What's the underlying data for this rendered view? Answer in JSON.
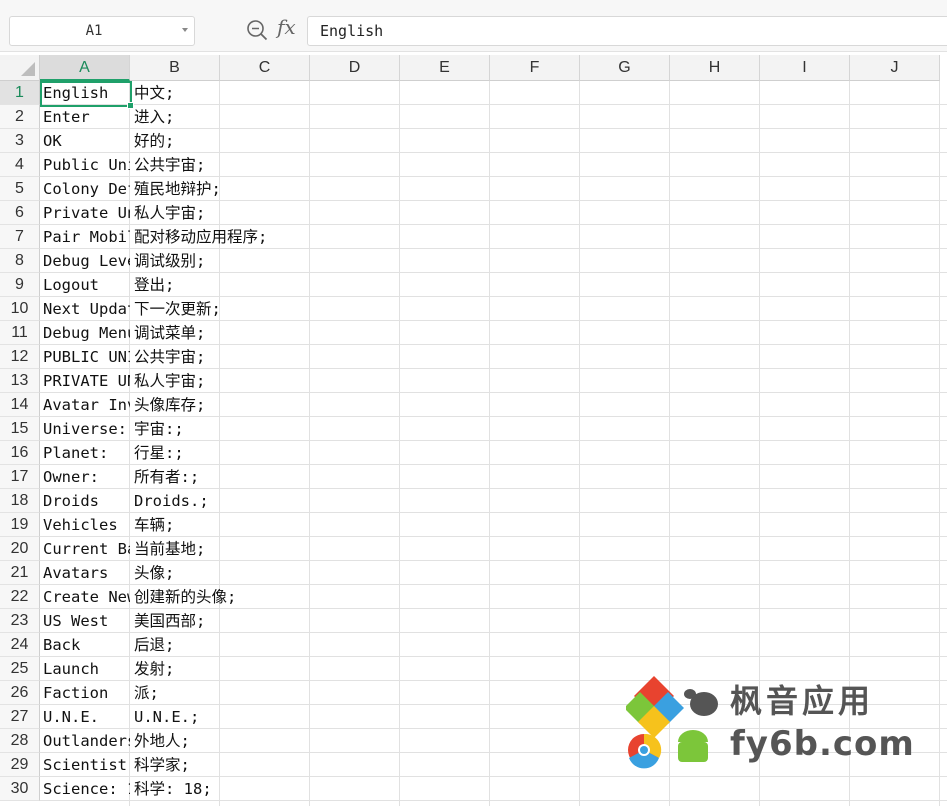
{
  "formula_bar": {
    "cell_ref": "A1",
    "fx_label": "fx",
    "content": "English"
  },
  "columns": [
    "A",
    "B",
    "C",
    "D",
    "E",
    "F",
    "G",
    "H",
    "I",
    "J"
  ],
  "active_column": "A",
  "active_row": 1,
  "rows": [
    {
      "n": "1",
      "a": "English",
      "b": "中文;"
    },
    {
      "n": "2",
      "a": "Enter",
      "b": "进入;"
    },
    {
      "n": "3",
      "a": "OK",
      "b": "好的;"
    },
    {
      "n": "4",
      "a": "Public Uni",
      "b": "公共宇宙;"
    },
    {
      "n": "5",
      "a": "Colony Def",
      "b": "殖民地辩护;"
    },
    {
      "n": "6",
      "a": "Private Un",
      "b": "私人宇宙;"
    },
    {
      "n": "7",
      "a": "Pair Mobil",
      "b": "配对移动应用程序;"
    },
    {
      "n": "8",
      "a": "Debug Leve",
      "b": "调试级别;"
    },
    {
      "n": "9",
      "a": "Logout",
      "b": "登出;"
    },
    {
      "n": "10",
      "a": "Next Updat",
      "b": "下一次更新;"
    },
    {
      "n": "11",
      "a": "Debug Menu",
      "b": "调试菜单;"
    },
    {
      "n": "12",
      "a": "PUBLIC UNI",
      "b": "公共宇宙;"
    },
    {
      "n": "13",
      "a": "PRIVATE UN",
      "b": "私人宇宙;"
    },
    {
      "n": "14",
      "a": "Avatar Inv",
      "b": "头像库存;"
    },
    {
      "n": "15",
      "a": "Universe: ",
      "b": "宇宙:;"
    },
    {
      "n": "16",
      "a": "Planet: ",
      "b": "行星:;"
    },
    {
      "n": "17",
      "a": "Owner: ",
      "b": "所有者:;"
    },
    {
      "n": "18",
      "a": "Droids",
      "b": "Droids.;"
    },
    {
      "n": "19",
      "a": "Vehicles",
      "b": "车辆;"
    },
    {
      "n": "20",
      "a": "Current Ba",
      "b": "当前基地;"
    },
    {
      "n": "21",
      "a": "Avatars",
      "b": "头像;"
    },
    {
      "n": "22",
      "a": "Create New",
      "b": "创建新的头像;"
    },
    {
      "n": "23",
      "a": "US West",
      "b": "美国西部;"
    },
    {
      "n": "24",
      "a": "Back",
      "b": "后退;"
    },
    {
      "n": "25",
      "a": "Launch",
      "b": "发射;"
    },
    {
      "n": "26",
      "a": "Faction",
      "b": "派;"
    },
    {
      "n": "27",
      "a": "U.N.E.",
      "b": "U.N.E.;"
    },
    {
      "n": "28",
      "a": "Outlanders",
      "b": "外地人;"
    },
    {
      "n": "29",
      "a": "Scientist",
      "b": "科学家;"
    },
    {
      "n": "30",
      "a": "Science: 1",
      "b": "科学: 18;"
    }
  ],
  "watermark": {
    "line1": "枫音应用",
    "line2": "fy6b.com",
    "colors": [
      "#e8432f",
      "#3aa0e0",
      "#f6c21c",
      "#7cc63a"
    ]
  }
}
